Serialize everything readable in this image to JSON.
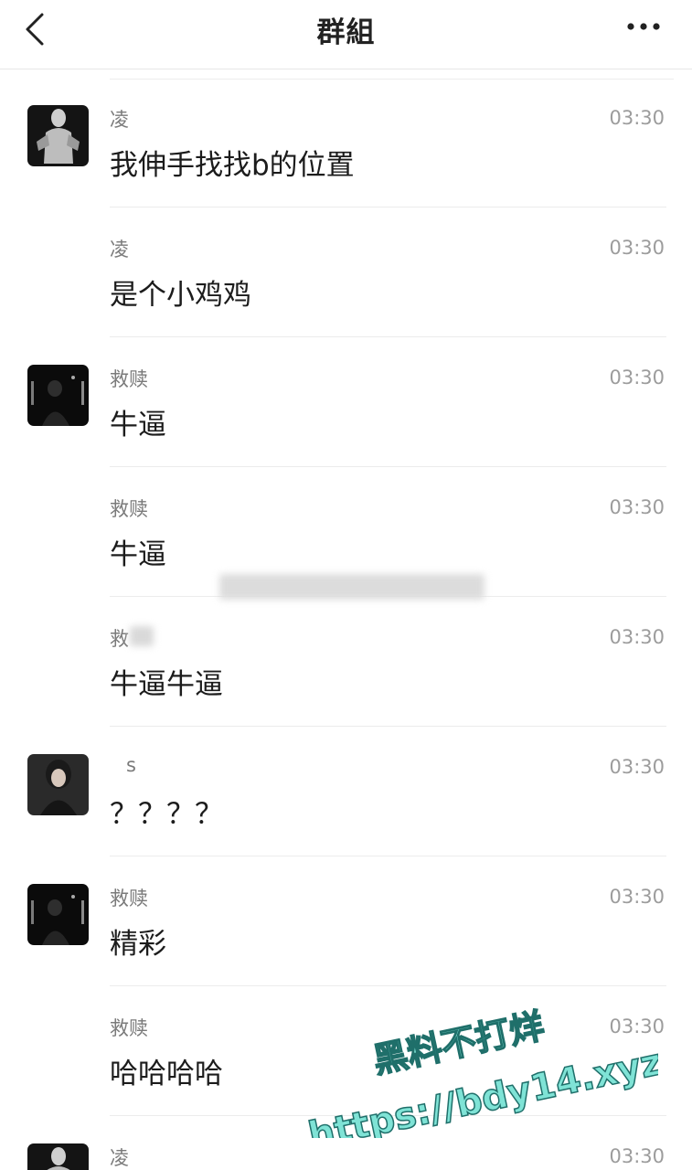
{
  "header": {
    "title": "群組"
  },
  "messages": [
    {
      "sender": "凌",
      "time": "03:30",
      "text": "我伸手找找b的位置",
      "avatar": "masked-figure"
    },
    {
      "sender": "凌",
      "time": "03:30",
      "text": "是个小鸡鸡",
      "avatar": ""
    },
    {
      "sender": "救赎",
      "time": "03:30",
      "text": "牛逼",
      "avatar": "dark-room"
    },
    {
      "sender": "救赎",
      "time": "03:30",
      "text": "牛逼",
      "avatar": ""
    },
    {
      "sender": "救",
      "time": "03:30",
      "text": "牛逼牛逼",
      "avatar": ""
    },
    {
      "sender": "s",
      "time": "03:30",
      "text": "？？？？",
      "avatar": "girl-portrait"
    },
    {
      "sender": "救赎",
      "time": "03:30",
      "text": "精彩",
      "avatar": "dark-room"
    },
    {
      "sender": "救赎",
      "time": "03:30",
      "text": "哈哈哈哈",
      "avatar": ""
    },
    {
      "sender": "凌",
      "time": "03:30",
      "text": "",
      "avatar": "masked-figure"
    }
  ],
  "watermark": {
    "line1": "黑料不打烊",
    "line2": "https://bdy14.xyz"
  }
}
